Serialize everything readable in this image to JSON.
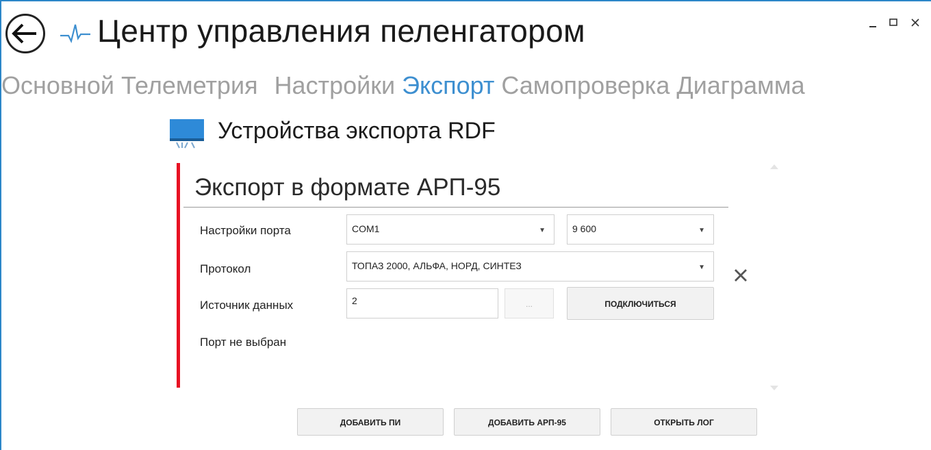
{
  "app": {
    "title": "Центр управления пеленгатором",
    "window_controls": {
      "minimize": "minimize-icon",
      "maximize": "maximize-icon",
      "close": "close-icon"
    }
  },
  "tabs": [
    {
      "label": "Основной",
      "active": false
    },
    {
      "label": "Телеметрия",
      "active": false
    },
    {
      "label": "Настройки",
      "active": false
    },
    {
      "label": "Экспорт",
      "active": true
    },
    {
      "label": "Самопроверка",
      "active": false
    },
    {
      "label": "Диаграмма",
      "active": false
    }
  ],
  "section": {
    "title": "Устройства экспорта RDF",
    "icon": "monitor-icon"
  },
  "panel": {
    "title": "Экспорт в формате АРП-95",
    "port_settings_label": "Настройки порта",
    "port_value": "COM1",
    "baud_value": "9 600",
    "protocol_label": "Протокол",
    "protocol_value": "ТОПАЗ 2000, АЛЬФА, НОРД, СИНТЕЗ",
    "source_label": "Источник данных",
    "source_value": "2",
    "browse_label": "...",
    "connect_label": "подключиться",
    "status": "Порт не выбран",
    "accent_color": "#e81123"
  },
  "footer": {
    "add_pi_label": "ДОБАВИТЬ ПИ",
    "add_arp_label": "ДОБАВИТЬ АРП-95",
    "open_log_label": "ОТКРЫТЬ ЛОГ"
  },
  "colors": {
    "active_tab": "#3d8fd0",
    "inactive_tab": "#a0a0a0",
    "window_border": "#2b86c8"
  }
}
